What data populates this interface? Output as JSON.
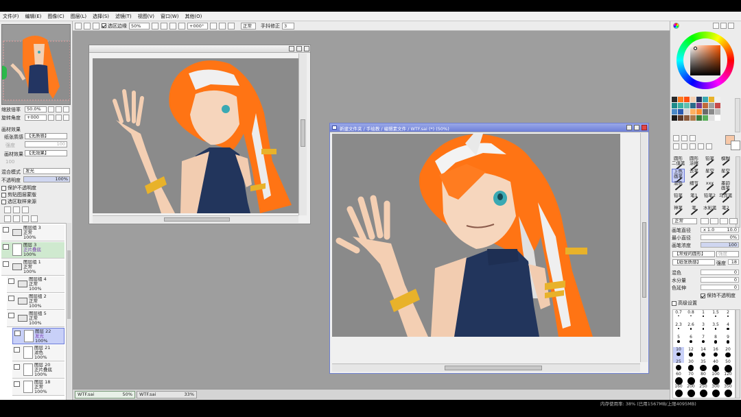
{
  "menu": [
    "文件(F)",
    "编辑(E)",
    "图像(C)",
    "图层(L)",
    "选择(S)",
    "滤镜(T)",
    "视图(V)",
    "窗口(W)",
    "其他(O)"
  ],
  "toolbar": {
    "selection_edge_label": "选区边缘",
    "zoom": "50%",
    "angle": "+000°",
    "blend_mode": "正常",
    "stabilizer_label": "手抖修正",
    "stabilizer_value": "3"
  },
  "left_panel": {
    "zoom_label": "缩放倍率",
    "zoom_value": "50.0%",
    "angle_label": "旋转角度",
    "angle_value": "+000",
    "paper_effect_header": "画材效果",
    "texture_label": "纸张质感",
    "texture_value": "【无质感】",
    "strength_label": "强度",
    "strength_value": "100",
    "effect_label": "画材效果",
    "effect_value": "【无效果】",
    "blend_label": "混合模式",
    "blend_value": "发光",
    "opacity_label": "不透明度",
    "opacity_value": "100%",
    "preserve_opacity": "保护不透明度",
    "clipping_group": "剪贴图层蒙版",
    "selection_source": "选区取样来源",
    "layers": [
      {
        "name": "图层组 3",
        "mode": "正常",
        "opacity": "100%",
        "kind": "folder",
        "indent": 0,
        "selected": false
      },
      {
        "name": "图层 3",
        "mode": "正片叠底",
        "opacity": "100%",
        "kind": "layer",
        "indent": 0,
        "selected": false,
        "highlight": true
      },
      {
        "name": "图层组 1",
        "mode": "正常",
        "opacity": "100%",
        "kind": "folder",
        "indent": 0,
        "selected": false
      },
      {
        "name": "图层组 4",
        "mode": "正常",
        "opacity": "100%",
        "kind": "folder",
        "indent": 1,
        "selected": false
      },
      {
        "name": "图层组 2",
        "mode": "正常",
        "opacity": "100%",
        "kind": "folder",
        "indent": 1,
        "selected": false
      },
      {
        "name": "图层组 5",
        "mode": "正常",
        "opacity": "100%",
        "kind": "folder",
        "indent": 1,
        "selected": false
      },
      {
        "name": "图层 22",
        "mode": "发光",
        "opacity": "100%",
        "kind": "layer",
        "indent": 2,
        "selected": true
      },
      {
        "name": "图层 21",
        "mode": "滤色",
        "opacity": "100%",
        "kind": "layer",
        "indent": 2,
        "selected": false
      },
      {
        "name": "图层 20",
        "mode": "正片叠底",
        "opacity": "100%",
        "kind": "layer",
        "indent": 2,
        "selected": false
      },
      {
        "name": "图层 18",
        "mode": "正常",
        "opacity": "100%",
        "kind": "layer",
        "indent": 2,
        "selected": false
      }
    ]
  },
  "documents": {
    "active_title": "新建文件夹 / 手绘教 / 编辑素文件 / WTF.sai (*) (50%)",
    "tabs": [
      {
        "name": "WTF.sai",
        "zoom": "50%"
      },
      {
        "name": "WTF.sai",
        "zoom": "33%"
      }
    ]
  },
  "right_panel": {
    "brushes": [
      [
        "圆形\n二值笔",
        "圆形\n涂擦",
        "铅笔",
        "模糊"
      ],
      [
        "上色\n画笔",
        "云笔",
        "星空",
        "星空"
      ],
      [
        "混色",
        "细节",
        "xxx",
        "墨韵\n画笔"
      ],
      [
        "铅笔",
        "笔1",
        "铅笔2",
        "马克笔"
      ],
      [
        "神笔",
        "笔",
        "水彩笔",
        "笔2"
      ]
    ],
    "brush_mode": "正常",
    "brush_size_label": "画笔直径",
    "brush_size_mult": "x 1.0",
    "brush_size_value": "10.0",
    "min_size_label": "最小直径",
    "min_size_value": "0%",
    "density_label": "画笔浓度",
    "density_value": "100",
    "shape_value": "【常规的圆形】",
    "shape_strength": "强度",
    "texture_value": "【纸张质感】",
    "texture_strength_label": "强度",
    "texture_strength": "18",
    "mix_label": "混色",
    "mix_value": "0",
    "water_label": "水分量",
    "water_value": "0",
    "persist_label": "色延伸",
    "persist_value": "0",
    "keep_opacity_label": "保持不透明度",
    "advanced_label": "高级设置",
    "sizes": [
      "0.7",
      "0.8",
      "1",
      "1.5",
      "2",
      "2.3",
      "2.6",
      "3",
      "3.5",
      "4",
      "5",
      "6",
      "7",
      "8",
      "9",
      "10",
      "12",
      "14",
      "16",
      "20",
      "25",
      "30",
      "35",
      "40",
      "50",
      "60",
      "70",
      "80",
      "100",
      "120",
      "160",
      "200",
      "250",
      "300",
      "350"
    ]
  },
  "status": {
    "memory": "内存使用率: 38%  (已用1567MB/上限4095MB)"
  }
}
